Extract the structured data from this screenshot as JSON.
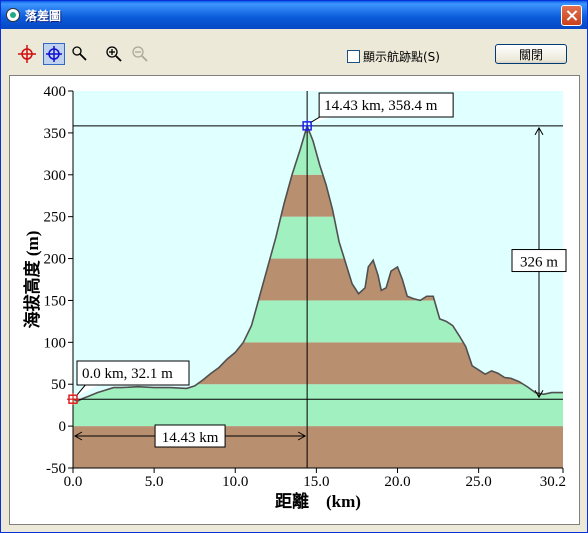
{
  "window": {
    "title": "落差圖"
  },
  "toolbar": {
    "tools": [
      {
        "name": "start-marker-tool",
        "icon": "crosshair-red-icon"
      },
      {
        "name": "end-marker-tool",
        "icon": "crosshair-blue-icon",
        "active": true
      },
      {
        "name": "magnifier-tool",
        "icon": "magnifier-icon"
      },
      {
        "name": "zoom-in-tool",
        "icon": "zoom-in-icon"
      },
      {
        "name": "zoom-out-tool",
        "icon": "zoom-out-icon",
        "disabled": true
      }
    ],
    "show_waypoints_label": "顯示航跡點(S)",
    "show_waypoints_checked": false,
    "close_label": "關閉"
  },
  "chart_data": {
    "type": "area",
    "xlabel": "距離　(km)",
    "ylabel": "海拔高度 (m)",
    "xlim": [
      0,
      30.2
    ],
    "ylim": [
      -50,
      400
    ],
    "xticks": [
      "0.0",
      "5.0",
      "10.0",
      "15.0",
      "20.0",
      "25.0",
      "30.2"
    ],
    "yticks": [
      "400",
      "350",
      "300",
      "250",
      "200",
      "150",
      "100",
      "50",
      "0",
      "-50"
    ],
    "profile_x": [
      0.0,
      0.3,
      0.6,
      1.0,
      1.5,
      2.0,
      2.5,
      3.0,
      4.0,
      5.0,
      6.0,
      7.0,
      7.5,
      8.0,
      8.5,
      9.0,
      9.5,
      10.0,
      10.5,
      11.0,
      11.5,
      12.0,
      12.5,
      13.0,
      13.5,
      14.0,
      14.43,
      14.8,
      15.2,
      15.6,
      16.0,
      16.4,
      16.8,
      17.2,
      17.6,
      18.0,
      18.2,
      18.5,
      18.8,
      19.0,
      19.3,
      19.6,
      20.0,
      20.3,
      20.6,
      21.0,
      21.4,
      21.8,
      22.2,
      22.6,
      23.0,
      23.4,
      23.8,
      24.2,
      24.6,
      25.0,
      25.4,
      25.8,
      26.2,
      26.6,
      27.0,
      27.5,
      28.0,
      28.5,
      29.0,
      29.5,
      30.2
    ],
    "profile_y": [
      32.1,
      30,
      33,
      36,
      40,
      43,
      46,
      46,
      47,
      46,
      46,
      45,
      48,
      55,
      63,
      70,
      80,
      88,
      100,
      120,
      155,
      190,
      225,
      265,
      300,
      330,
      358.4,
      340,
      312,
      288,
      258,
      220,
      195,
      170,
      158,
      165,
      190,
      198,
      180,
      162,
      165,
      185,
      190,
      175,
      155,
      152,
      150,
      155,
      155,
      128,
      125,
      120,
      108,
      95,
      72,
      67,
      62,
      66,
      63,
      58,
      57,
      53,
      47,
      40,
      38,
      40,
      40
    ],
    "band_boundaries": [
      -50,
      0,
      50,
      100,
      150,
      200,
      250,
      300,
      350
    ],
    "band_colors": [
      "#b89070",
      "#a0f0c0"
    ],
    "background": "#e0ffff",
    "markers": [
      {
        "id": "start",
        "x": 0.0,
        "y": 32.1,
        "label": "0.0 km, 32.1 m",
        "color": "#e02020"
      },
      {
        "id": "end",
        "x": 14.43,
        "y": 358.4,
        "label": "14.43 km, 358.4 m",
        "color": "#2020e0"
      }
    ],
    "distance_label": "14.43 km",
    "elevation_diff_label": "326 m"
  }
}
